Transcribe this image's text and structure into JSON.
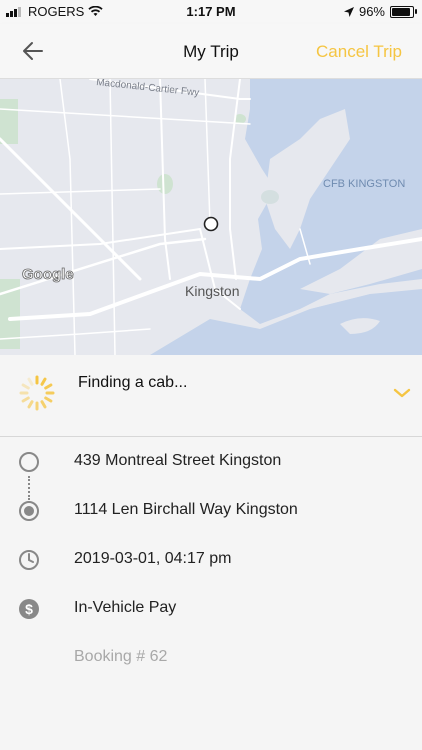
{
  "status_bar": {
    "carrier": "ROGERS",
    "time": "1:17 PM",
    "battery": "96%",
    "battery_level": 0.96
  },
  "nav": {
    "title": "My Trip",
    "cancel_label": "Cancel Trip",
    "back_icon": "arrow-left-icon"
  },
  "map": {
    "labels": {
      "highway": "Macdonald-Cartier Fwy",
      "base": "CFB KINGSTON",
      "city": "Kingston",
      "provider": "Google"
    }
  },
  "trip_status": {
    "text": "Finding a cab...",
    "spinner_icon": "loading-spinner-icon",
    "expand_icon": "chevron-down-icon"
  },
  "trip": {
    "pickup": "439 Montreal Street Kingston",
    "dropoff": "1114 Len Birchall Way Kingston",
    "datetime": "2019-03-01, 04:17 pm",
    "payment": "In-Vehicle Pay",
    "booking": "Booking # 62"
  },
  "colors": {
    "accent": "#f5c542",
    "water": "#c4d3ea",
    "land": "#e6e8ee",
    "park": "#cfe3d1"
  }
}
